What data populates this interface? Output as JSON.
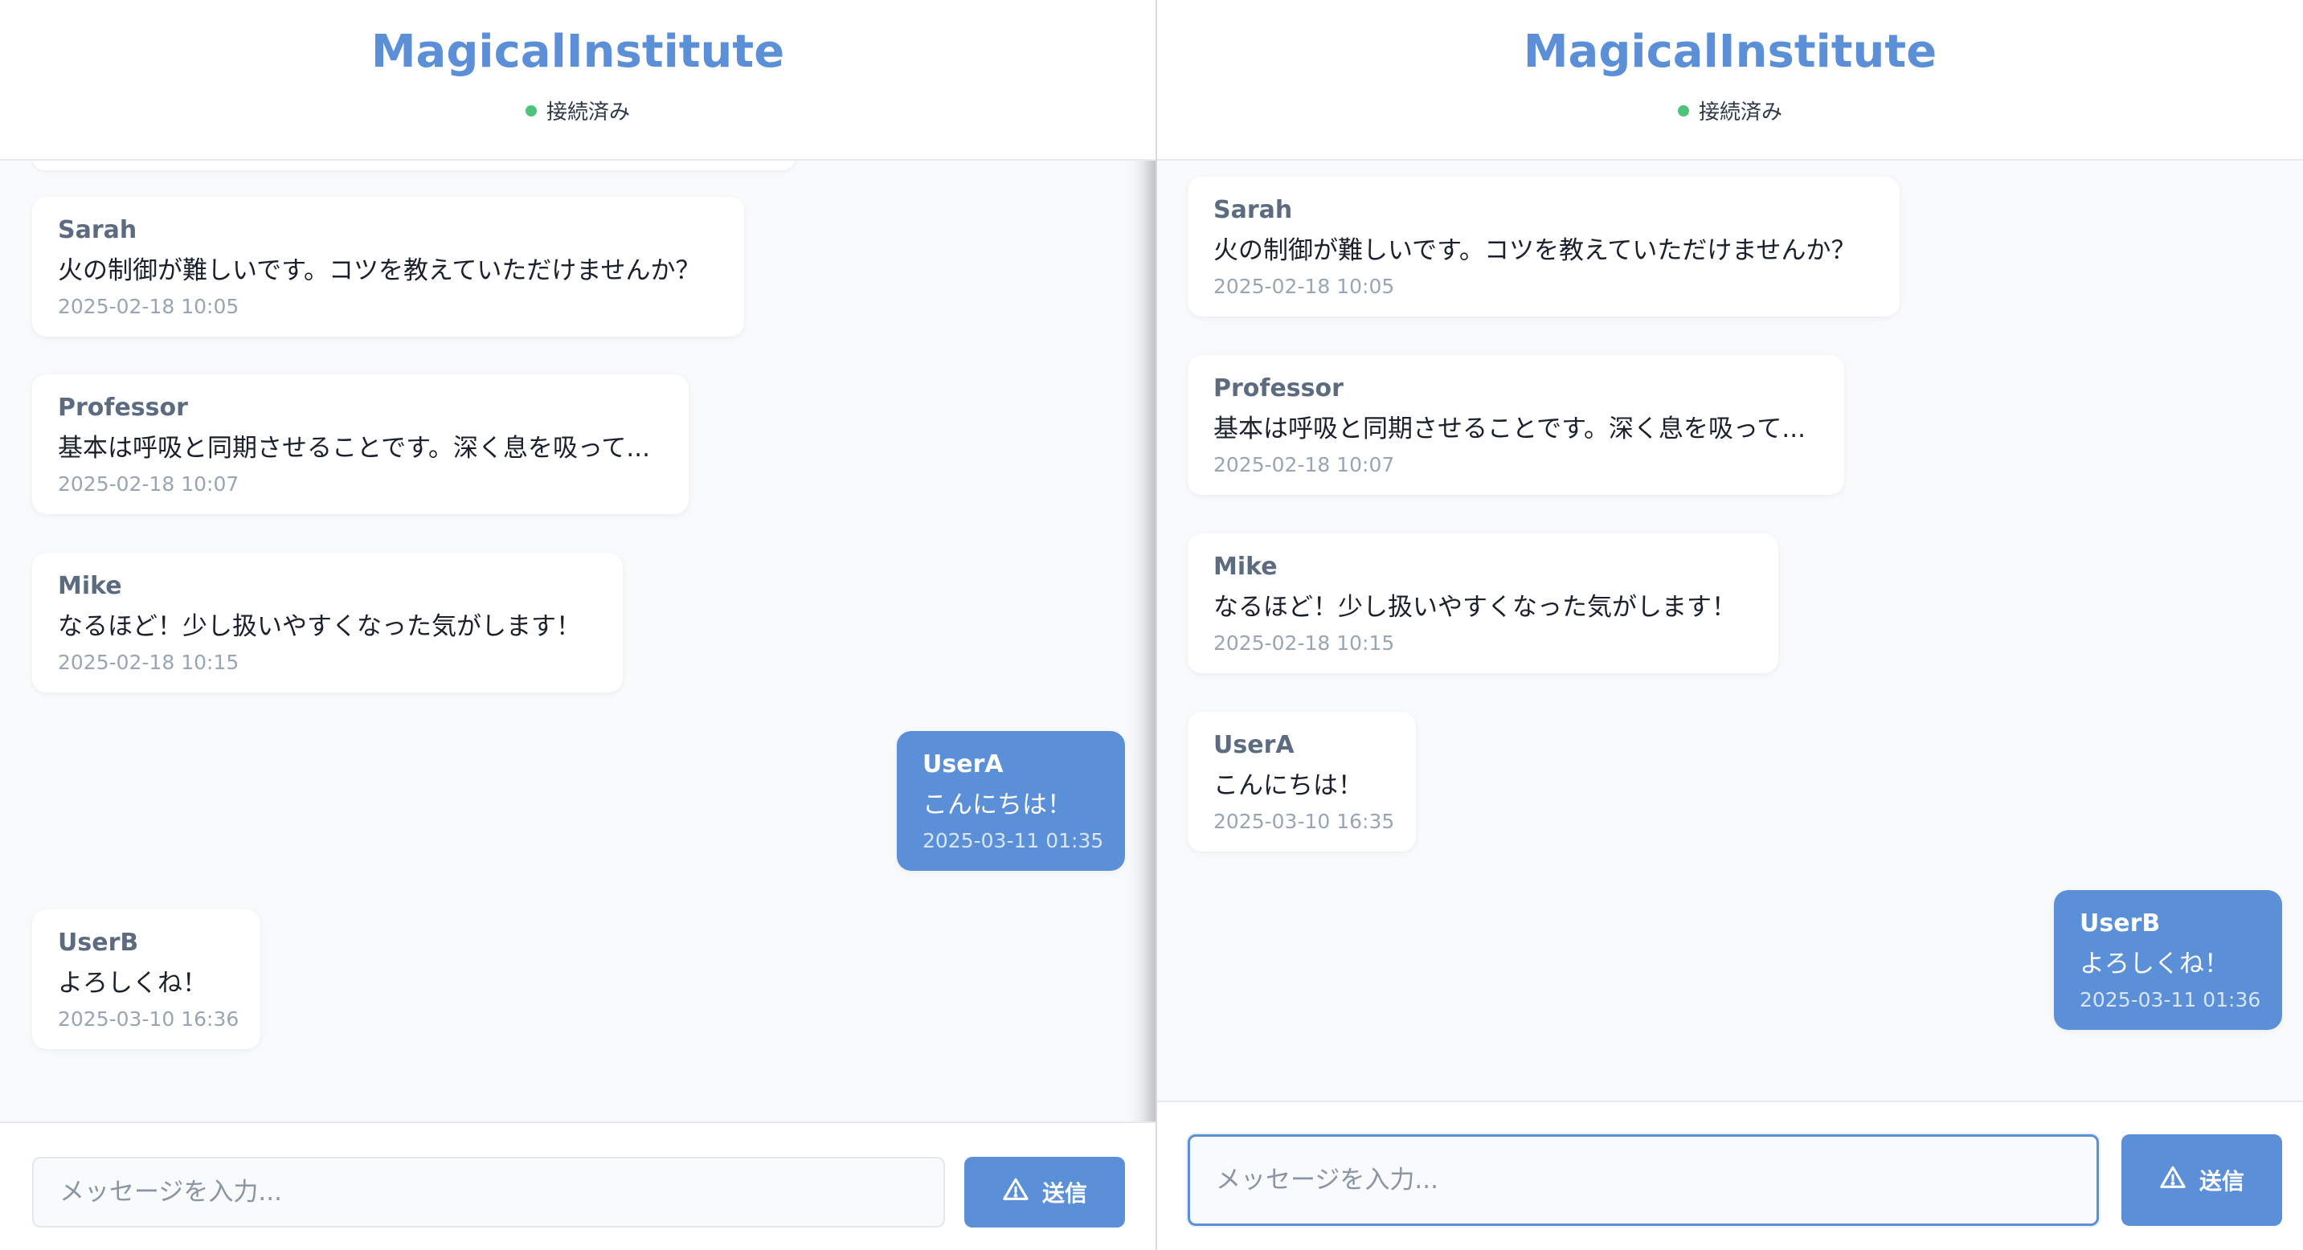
{
  "colors": {
    "accent": "#5b8fd8",
    "status_online": "#4fc37a"
  },
  "left": {
    "header": {
      "title": "MagicalInstitute",
      "status": "接続済み"
    },
    "messages": [
      {
        "sender": "Sarah",
        "text": "火の制御が難しいです。コツを教えていただけませんか？",
        "time": "2025-02-18 10:05",
        "own": false
      },
      {
        "sender": "Professor",
        "text": "基本は呼吸と同期させることです。深く息を吸って...",
        "time": "2025-02-18 10:07",
        "own": false
      },
      {
        "sender": "Mike",
        "text": "なるほど！少し扱いやすくなった気がします！",
        "time": "2025-02-18 10:15",
        "own": false
      },
      {
        "sender": "UserA",
        "text": "こんにちは！",
        "time": "2025-03-11 01:35",
        "own": true
      },
      {
        "sender": "UserB",
        "text": "よろしくね！",
        "time": "2025-03-10 16:36",
        "own": false
      }
    ],
    "input": {
      "placeholder": "メッセージを入力...",
      "value": ""
    },
    "send_label": "送信",
    "send_icon": "warning-triangle-icon"
  },
  "right": {
    "header": {
      "title": "MagicalInstitute",
      "status": "接続済み"
    },
    "messages": [
      {
        "sender": "Sarah",
        "text": "火の制御が難しいです。コツを教えていただけませんか？",
        "time": "2025-02-18 10:05",
        "own": false
      },
      {
        "sender": "Professor",
        "text": "基本は呼吸と同期させることです。深く息を吸って...",
        "time": "2025-02-18 10:07",
        "own": false
      },
      {
        "sender": "Mike",
        "text": "なるほど！少し扱いやすくなった気がします！",
        "time": "2025-02-18 10:15",
        "own": false
      },
      {
        "sender": "UserA",
        "text": "こんにちは！",
        "time": "2025-03-10 16:35",
        "own": false
      },
      {
        "sender": "UserB",
        "text": "よろしくね！",
        "time": "2025-03-11 01:36",
        "own": true
      }
    ],
    "input": {
      "placeholder": "メッセージを入力...",
      "value": ""
    },
    "send_label": "送信",
    "send_icon": "warning-triangle-icon"
  }
}
